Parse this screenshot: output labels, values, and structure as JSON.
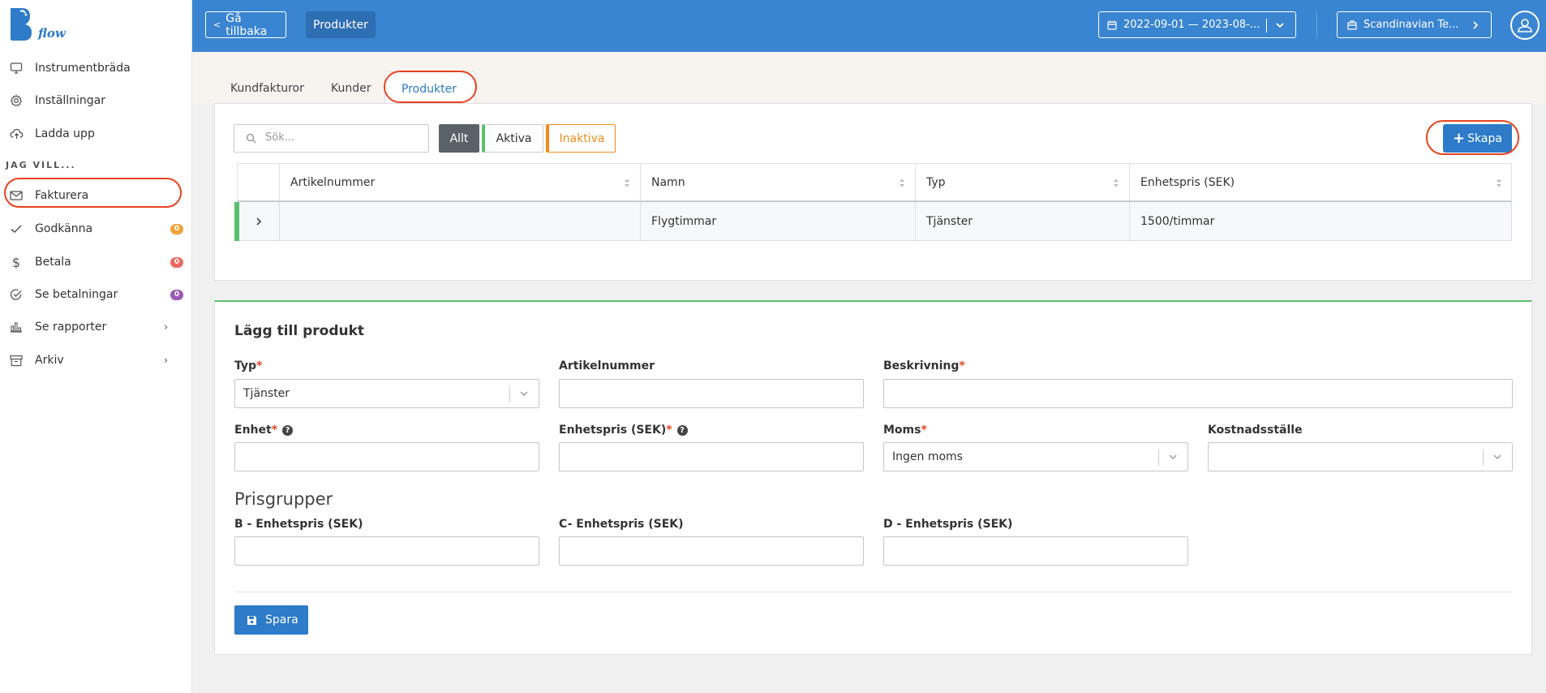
{
  "brand": {
    "logo_text": "flow",
    "logo_letter": "B",
    "color": "#2d7bc9"
  },
  "sidebar": {
    "items": [
      {
        "label": "Instrumentbräda",
        "icon": "monitor-icon"
      },
      {
        "label": "Inställningar",
        "icon": "gear-icon"
      },
      {
        "label": "Ladda upp",
        "icon": "cloud-upload-icon"
      }
    ],
    "section_label": "JAG VILL...",
    "actions": [
      {
        "label": "Fakturera",
        "icon": "mail-icon"
      },
      {
        "label": "Godkänna",
        "icon": "check-icon",
        "badge": "0",
        "badge_color": "#f0a43c"
      },
      {
        "label": "Betala",
        "icon": "dollar-icon",
        "badge": "0",
        "badge_color": "#ea6a63"
      },
      {
        "label": "Se betalningar",
        "icon": "check-circle-icon",
        "badge": "0",
        "badge_color": "#9b59b6"
      },
      {
        "label": "Se rapporter",
        "icon": "bar-chart-icon",
        "chevron": "›"
      },
      {
        "label": "Arkiv",
        "icon": "archive-icon",
        "chevron": "›"
      }
    ]
  },
  "topbar": {
    "back_label": "Gå tillbaka",
    "crumb": "Produkter",
    "date_range": "2022-09-01 — 2023-08-...",
    "company": "Scandinavian Te..."
  },
  "tabs": [
    {
      "label": "Kundfakturor",
      "active": false
    },
    {
      "label": "Kunder",
      "active": false
    },
    {
      "label": "Produkter",
      "active": true
    }
  ],
  "filters": {
    "search_placeholder": "Sök...",
    "all": "Allt",
    "active": "Aktiva",
    "inactive": "Inaktiva",
    "create": "Skapa"
  },
  "table": {
    "columns": [
      "Artikelnummer",
      "Namn",
      "Typ",
      "Enhetspris (SEK)"
    ],
    "rows": [
      {
        "artikelnummer": "",
        "namn": "Flygtimmar",
        "typ": "Tjänster",
        "enhetspris": "1500/timmar",
        "status_color": "#5cbf6e"
      }
    ]
  },
  "form": {
    "title": "Lägg till produkt",
    "typ_label": "Typ",
    "typ_value": "Tjänster",
    "artikelnummer_label": "Artikelnummer",
    "beskrivning_label": "Beskrivning",
    "enhet_label": "Enhet",
    "enhetspris_label": "Enhetspris (SEK)",
    "moms_label": "Moms",
    "moms_value": "Ingen moms",
    "kostnadsstalle_label": "Kostnadsställe",
    "prisgrupper_title": "Prisgrupper",
    "b_label": "B - Enhetspris (SEK)",
    "c_label": "C- Enhetspris (SEK)",
    "d_label": "D - Enhetspris (SEK)",
    "save_label": "Spara",
    "required_mark": "*",
    "help_mark": "?"
  }
}
